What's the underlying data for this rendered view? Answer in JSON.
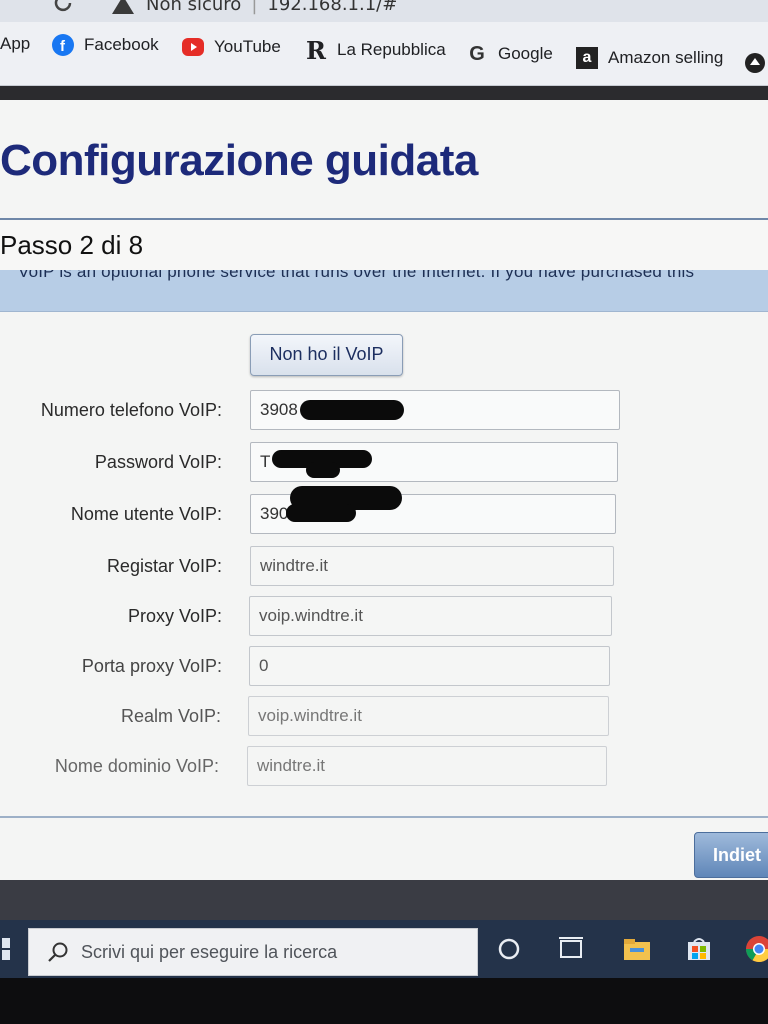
{
  "browser": {
    "security_label": "Non sicuro",
    "url": "192.168.1.1/#",
    "bookmarks": [
      {
        "label": "App",
        "icon": "apps-grid-icon"
      },
      {
        "label": "Facebook",
        "icon": "facebook-icon"
      },
      {
        "label": "YouTube",
        "icon": "youtube-icon"
      },
      {
        "label": "La Repubblica",
        "icon": "repubblica-icon"
      },
      {
        "label": "Google",
        "icon": "google-icon"
      },
      {
        "label": "Amazon selling",
        "icon": "amazon-icon"
      }
    ]
  },
  "wizard": {
    "title": "Configurazione guidata",
    "step": "Passo 2 di 8",
    "info": "VoIP is an optional phone service that runs over the Internet. If you have purchased this",
    "no_voip_button": "Non ho il VoIP",
    "back_button": "Indiet",
    "fields": [
      {
        "label": "Numero telefono VoIP:",
        "value": "3908",
        "redacted": true
      },
      {
        "label": "Password VoIP:",
        "value": "T",
        "redacted": true
      },
      {
        "label": "Nome utente VoIP:",
        "value": "390",
        "redacted": true
      },
      {
        "label": "Registar VoIP:",
        "value": "windtre.it"
      },
      {
        "label": "Proxy VoIP:",
        "value": "voip.windtre.it"
      },
      {
        "label": "Porta proxy VoIP:",
        "value": "0"
      },
      {
        "label": "Realm VoIP:",
        "value": "voip.windtre.it"
      },
      {
        "label": "Nome dominio VoIP:",
        "value": "windtre.it"
      }
    ]
  },
  "taskbar": {
    "search_placeholder": "Scrivi qui per eseguire la ricerca",
    "icons": [
      "start-icon",
      "search-icon",
      "cortana-icon",
      "task-view-icon",
      "file-explorer-icon",
      "store-icon",
      "chrome-icon"
    ]
  },
  "colors": {
    "title": "#1d2a7a",
    "info_band": "#b7cde6",
    "button_primary": "#5f86b8",
    "taskbar": "#24334a"
  }
}
